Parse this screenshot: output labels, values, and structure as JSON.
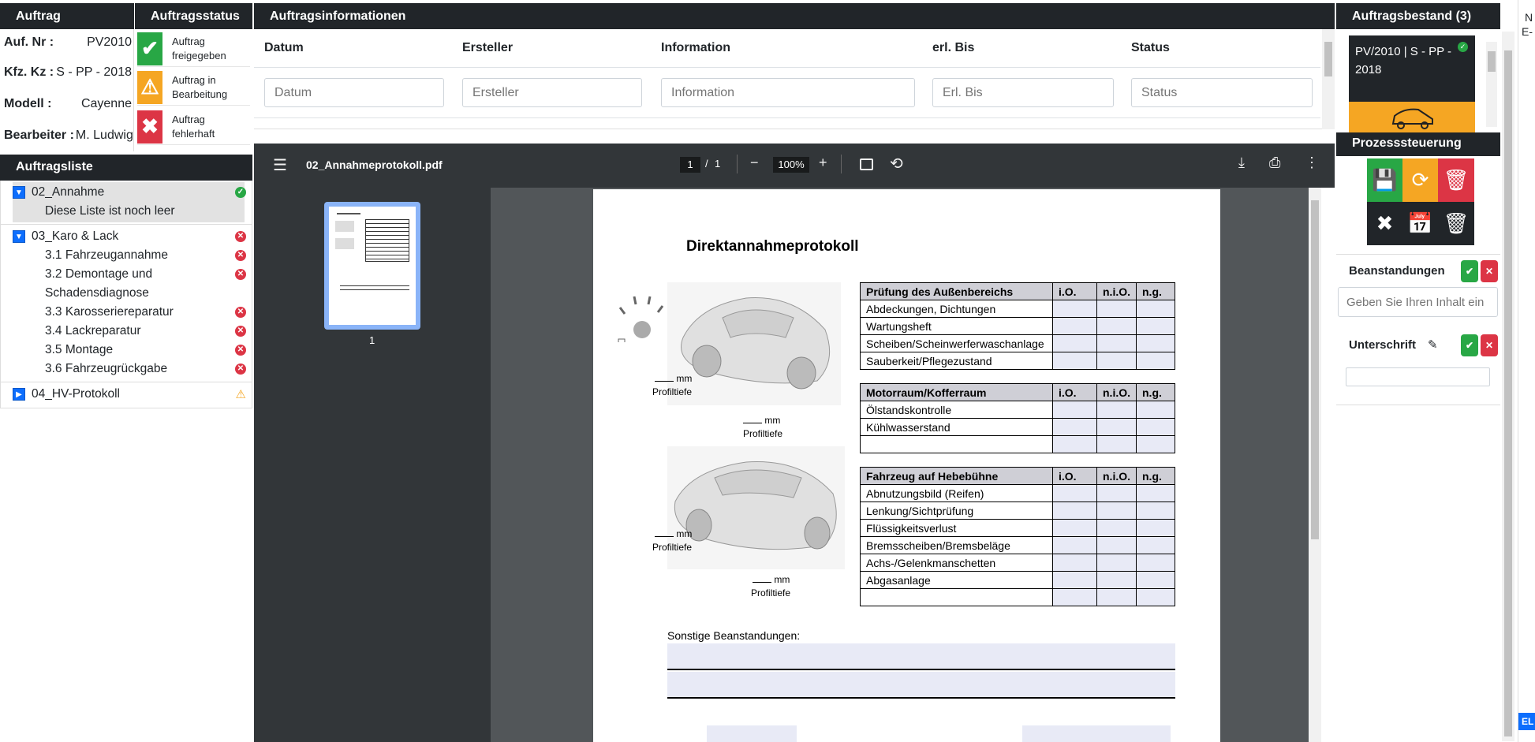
{
  "auftrag": {
    "header": "Auftrag",
    "fields": [
      {
        "label": "Auf. Nr :",
        "value": "PV2010"
      },
      {
        "label": "Kfz. Kz :",
        "value": "S - PP - 2018"
      },
      {
        "label": "Modell :",
        "value": "Cayenne"
      },
      {
        "label": "Bearbeiter :",
        "value": "M. Ludwig"
      }
    ]
  },
  "auftragsstatus": {
    "header": "Auftragsstatus",
    "items": [
      {
        "line1": "Auftrag",
        "line2": "freigegeben",
        "icon": "check-icon",
        "color": "#28a745"
      },
      {
        "line1": "Auftrag in",
        "line2": "Bearbeitung",
        "icon": "warning-icon",
        "color": "#f5a623"
      },
      {
        "line1": "Auftrag",
        "line2": "fehlerhaft",
        "icon": "x-icon",
        "color": "#dc3545"
      }
    ]
  },
  "auftragsliste": {
    "header": "Auftragsliste",
    "groups": [
      {
        "label": "02_Annahme",
        "status": "ok",
        "note": "Diese Liste ist noch leer"
      },
      {
        "label": "03_Karo & Lack",
        "status": "error",
        "children": [
          {
            "label": "3.1 Fahrzeugannahme"
          },
          {
            "label": "3.2 Demontage und",
            "label2": "Schadensdiagnose"
          },
          {
            "label": "3.3 Karosseriereparatur"
          },
          {
            "label": "3.4 Lackreparatur"
          },
          {
            "label": "3.5 Montage"
          },
          {
            "label": "3.6 Fahrzeugrückgabe"
          }
        ]
      },
      {
        "label": "04_HV-Protokoll",
        "status": "warning"
      }
    ]
  },
  "auftragsinformationen": {
    "header": "Auftragsinformationen",
    "columns": [
      "Datum",
      "Ersteller",
      "Information",
      "erl. Bis",
      "Status"
    ],
    "placeholders": [
      "Datum",
      "Ersteller",
      "Information",
      "Erl. Bis",
      "Status"
    ]
  },
  "pdf": {
    "filename": "02_Annahmeprotokoll.pdf",
    "page": "1",
    "page_total": "1",
    "zoom": "100%",
    "thumb_label": "1",
    "doc_title": "Direktannahmeprotokoll",
    "mm": "mm",
    "profiltiefe": "Profiltiefe",
    "table1": {
      "header": "Prüfung des Außenbereichs",
      "cols": [
        "i.O.",
        "n.i.O.",
        "n.g."
      ],
      "rows": [
        "Abdeckungen, Dichtungen",
        "Wartungsheft",
        "Scheiben/Scheinwerferwaschanlage",
        "Sauberkeit/Pflegezustand"
      ]
    },
    "table2": {
      "header": "Motorraum/Kofferraum",
      "cols": [
        "i.O.",
        "n.i.O.",
        "n.g."
      ],
      "rows": [
        "Ölstandskontrolle",
        "Kühlwasserstand",
        ""
      ]
    },
    "table3": {
      "header": "Fahrzeug auf Hebebühne",
      "cols": [
        "i.O.",
        "n.i.O.",
        "n.g."
      ],
      "rows": [
        "Abnutzungsbild (Reifen)",
        "Lenkung/Sichtprüfung",
        "Flüssigkeitsverlust",
        "Bremsscheiben/Bremsbeläge",
        "Achs-/Gelenkmanschetten",
        "Abgasanlage",
        ""
      ]
    },
    "sonstige": "Sonstige Beanstandungen:"
  },
  "auftragsbestand": {
    "header": "Auftragsbestand (3)",
    "card_line1": "PV/2010 | S - PP -",
    "card_line2": "2018"
  },
  "prozesssteuerung": {
    "header": "Prozesssteuerung",
    "colors": {
      "save": "#28a745",
      "refresh": "#f5a623",
      "delete": "#dc3545",
      "dark": "#212529"
    }
  },
  "beanstandungen": {
    "label": "Beanstandungen",
    "placeholder": "Geben Sie Ihren Inhalt ein"
  },
  "unterschrift": {
    "label": "Unterschrift"
  },
  "edge": {
    "text1": "N",
    "text2": "E-",
    "badge": "EL"
  }
}
